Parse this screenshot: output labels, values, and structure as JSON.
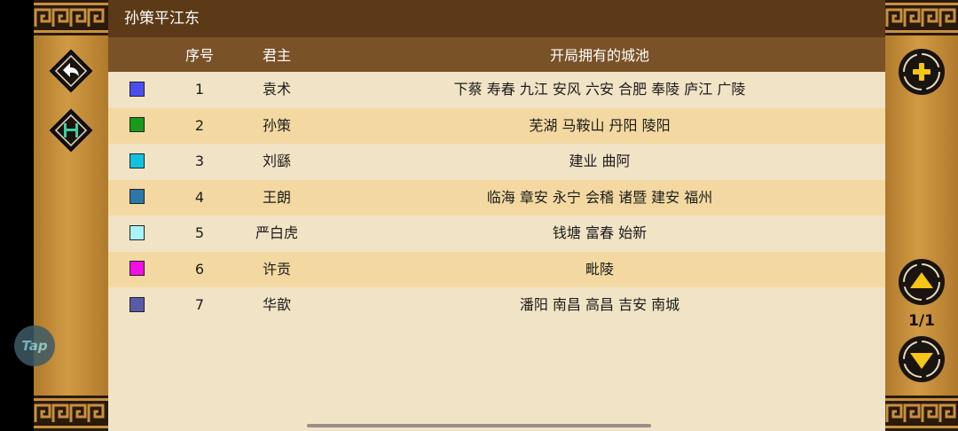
{
  "title": "孙策平江东",
  "table": {
    "headers": {
      "index": "序号",
      "lord": "君主",
      "cities": "开局拥有的城池"
    },
    "rows": [
      {
        "index": "1",
        "lord": "袁术",
        "cities": "下蔡 寿春 九江 安风 六安 合肥 奉陵 庐江 广陵",
        "color": "#4b4ff0"
      },
      {
        "index": "2",
        "lord": "孙策",
        "cities": "芜湖 马鞍山 丹阳 陵阳",
        "color": "#1a9a1a"
      },
      {
        "index": "3",
        "lord": "刘繇",
        "cities": "建业 曲阿",
        "color": "#12c0e0"
      },
      {
        "index": "4",
        "lord": "王朗",
        "cities": "临海 章安 永宁 会稽 诸暨 建安 福州",
        "color": "#2c78a8"
      },
      {
        "index": "5",
        "lord": "严白虎",
        "cities": "钱塘 富春 始新",
        "color": "#a8f4f8"
      },
      {
        "index": "6",
        "lord": "许贡",
        "cities": "毗陵",
        "color": "#ee10e4"
      },
      {
        "index": "7",
        "lord": "华歆",
        "cities": "潘阳 南昌 高昌 吉安 南城",
        "color": "#5a5aaa"
      }
    ]
  },
  "pagination": {
    "page": "1/1"
  },
  "floating_button": {
    "label": "Tap"
  },
  "icons": {
    "back": "back-arrow-icon",
    "save": "save-icon",
    "add": "plus-icon",
    "up": "up-arrow-icon",
    "down": "down-arrow-icon"
  }
}
